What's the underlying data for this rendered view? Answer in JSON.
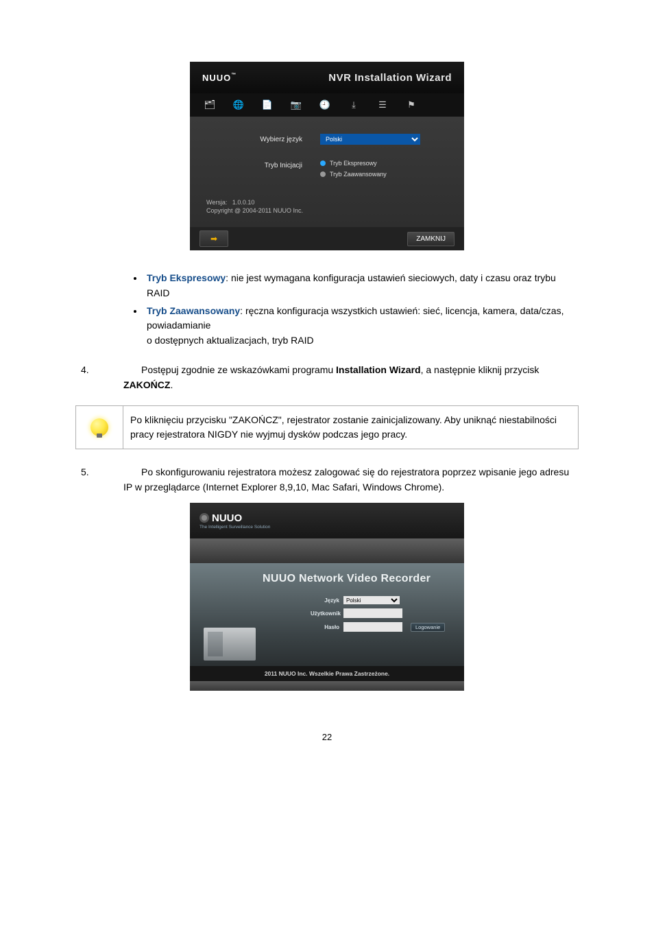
{
  "wizard": {
    "brand": "NUUO",
    "tm": "™",
    "title": "NVR Installation Wizard",
    "labels": {
      "language": "Wybierz język",
      "mode": "Tryb Inicjacji"
    },
    "language_value": "Polski",
    "modes": {
      "express": "Tryb Ekspresowy",
      "advanced": "Tryb Zaawansowany"
    },
    "version_label": "Wersja:",
    "version_value": "1.0.0.10",
    "copyright": "Copyright @ 2004-2011 NUUO Inc.",
    "close": "ZAMKNIJ"
  },
  "modes_text": {
    "express_name": "Tryb Ekspresowy",
    "express_desc": ": nie jest wymagana konfiguracja ustawień sieciowych, daty i czasu oraz trybu RAID",
    "advanced_name": "Tryb Zaawansowany",
    "advanced_desc_1": ": ręczna konfiguracja wszystkich ustawień: sieć, licencja, kamera, data/czas, powiadamianie",
    "advanced_desc_2": "o dostępnych aktualizacjach, tryb RAID"
  },
  "step4": {
    "num": "4.",
    "text_1": "Postępuj zgodnie ze wskazówkami programu ",
    "bold_1": "Installation Wizard",
    "text_2": ", a następnie kliknij przycisk ",
    "bold_2": "ZAKOŃCZ",
    "text_3": "."
  },
  "tip": "Po kliknięciu przycisku \"ZAKOŃCZ\", rejestrator zostanie zainicjalizowany. Aby uniknąć niestabilności pracy rejestratora NIGDY nie wyjmuj dysków podczas jego pracy.",
  "step5": {
    "num": "5.",
    "text": "Po skonfigurowaniu rejestratora możesz zalogować się do rejestratora poprzez wpisanie jego adresu IP w przeglądarce (Internet Explorer 8,9,10, Mac Safari, Windows Chrome)."
  },
  "login": {
    "brand": "NUUO",
    "tagline": "The Intelligent Surveillance Solution",
    "title": "NUUO Network Video Recorder",
    "lang_label": "Język",
    "lang_value": "Polski",
    "user_label": "Użytkownik",
    "pass_label": "Hasło",
    "login_btn": "Logowanie",
    "copyright": "2011 NUUO Inc. Wszelkie Prawa Zastrzeżone."
  },
  "page_number": "22"
}
